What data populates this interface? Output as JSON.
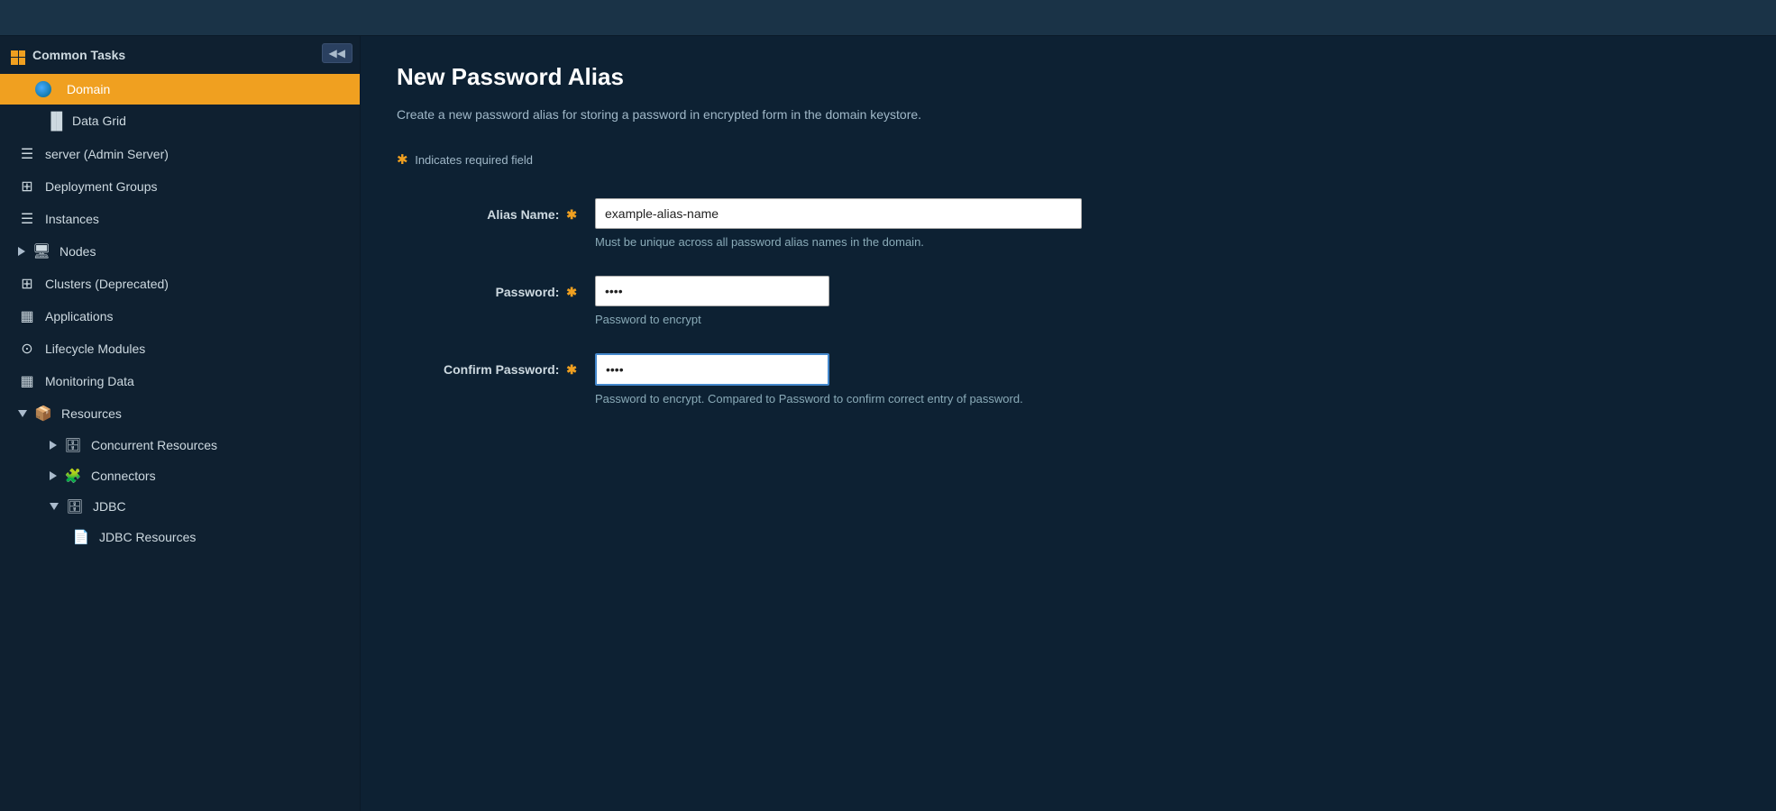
{
  "sidebar": {
    "collapse_btn": "◀◀",
    "common_tasks_label": "Common Tasks",
    "domain_label": "Domain",
    "data_grid_label": "Data Grid",
    "server_label": "server (Admin Server)",
    "deployment_groups_label": "Deployment Groups",
    "instances_label": "Instances",
    "nodes_label": "Nodes",
    "clusters_label": "Clusters (Deprecated)",
    "applications_label": "Applications",
    "lifecycle_modules_label": "Lifecycle Modules",
    "monitoring_data_label": "Monitoring Data",
    "resources_label": "Resources",
    "concurrent_resources_label": "Concurrent Resources",
    "connectors_label": "Connectors",
    "jdbc_label": "JDBC",
    "jdbc_resources_label": "JDBC Resources"
  },
  "main": {
    "page_title": "New Password Alias",
    "page_description": "Create a new password alias for storing a password in encrypted form in the domain keystore.",
    "required_note": "Indicates required field",
    "form": {
      "alias_name_label": "Alias Name:",
      "alias_name_value": "example-alias-name",
      "alias_name_hint": "Must be unique across all password alias names in the domain.",
      "password_label": "Password:",
      "password_value": "••••",
      "password_hint": "Password to encrypt",
      "confirm_password_label": "Confirm Password:",
      "confirm_password_value": "••••",
      "confirm_password_hint": "Password to encrypt. Compared to Password to confirm correct entry of password."
    }
  }
}
